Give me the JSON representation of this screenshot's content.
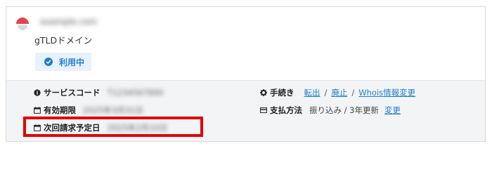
{
  "colors": {
    "accent": "#1f7ed0",
    "highlight": "#e0000b",
    "logo": "#e8414f"
  },
  "domain": {
    "name": "example.com",
    "tld_type": "gTLDドメイン",
    "status": {
      "icon": "check-circle-icon",
      "label": "利用中"
    }
  },
  "details": {
    "service_code": {
      "icon": "info-icon",
      "label": "サービスコード",
      "value": "T1234567890"
    },
    "expiry": {
      "icon": "calendar-icon",
      "label": "有効期限",
      "value": "2025年3月31日"
    },
    "next_billing": {
      "icon": "calendar-icon",
      "label": "次回請求予定日",
      "value": "2025年2月10日"
    },
    "procedures": {
      "icon": "gear-icon",
      "label": "手続き",
      "links": [
        "転出",
        "廃止",
        "Whois情報変更"
      ],
      "separator": "/"
    },
    "payment": {
      "icon": "credit-card-icon",
      "label": "支払方法",
      "value": "振り込み / 3年更新",
      "change_link": "変更"
    }
  }
}
